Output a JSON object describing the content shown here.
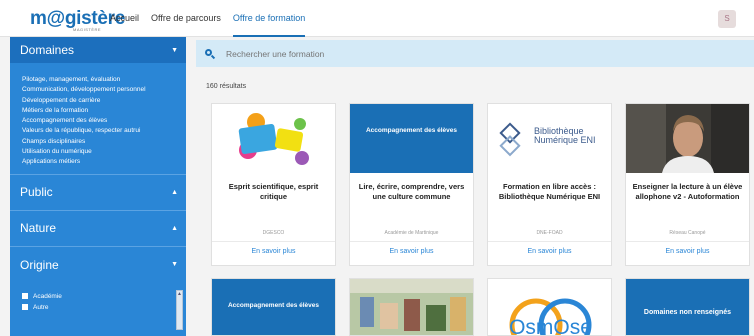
{
  "header": {
    "logo": "m@gistère",
    "logo_sub": "MAGISTÈRE",
    "nav": [
      "Accueil",
      "Offre de parcours",
      "Offre de formation"
    ],
    "avatar_text": "S"
  },
  "sidebar": {
    "domaines_title": "Domaines",
    "domaines": [
      "Pilotage, management, évaluation",
      "Communication, développement personnel",
      "Développement de carrière",
      "Métiers de la formation",
      "Accompagnement des élèves",
      "Valeurs de la république, respecter autrui",
      "Champs disciplinaires",
      "Utilisation du numérique",
      "Applications métiers"
    ],
    "public_title": "Public",
    "nature_title": "Nature",
    "origine_title": "Origine",
    "origine": [
      "Académie",
      "Autre"
    ]
  },
  "search": {
    "placeholder": "Rechercher une formation"
  },
  "results": {
    "count_text": "160 résultats"
  },
  "cards": [
    {
      "thumb_text": "",
      "title": "Esprit scientifique, esprit critique",
      "source": "DGESCO",
      "more": "En savoir plus"
    },
    {
      "thumb_text": "Accompagnement des élèves",
      "title": "Lire, écrire, comprendre, vers une culture commune",
      "source": "Académie de Martinique",
      "more": "En savoir plus"
    },
    {
      "thumb_text": "Bibliothèque Numérique ENI",
      "title": "Formation en libre accès : Bibliothèque Numérique ENI",
      "source": "DNE-FOAD",
      "more": "En savoir plus"
    },
    {
      "thumb_text": "",
      "title": "Enseigner la lecture à un élève allophone v2 - Autoformation",
      "source": "Réseau Canopé",
      "more": "En savoir plus"
    }
  ],
  "cards_row2": [
    {
      "thumb_text": "Accompagnement des élèves"
    },
    {
      "thumb_text": ""
    },
    {
      "thumb_text": "OsmOse"
    },
    {
      "thumb_text": "Domaines non renseignés"
    }
  ],
  "colors": {
    "primary": "#2a86d6",
    "dark": "#1a6fb5",
    "search_bg": "#d4eaf7"
  }
}
